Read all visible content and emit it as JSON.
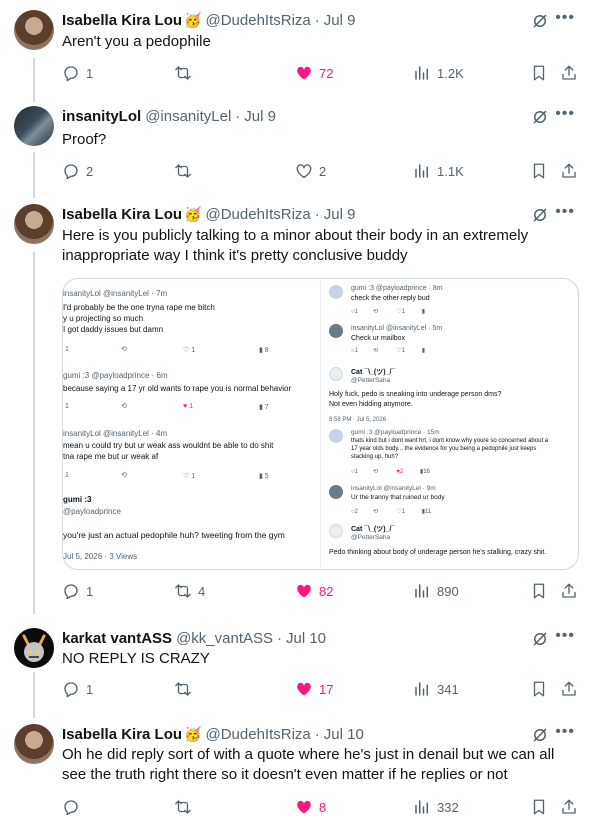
{
  "colors": {
    "like": "#f91880",
    "muted": "#536471",
    "text": "#0f1419",
    "line": "#cfd9de"
  },
  "tweets": [
    {
      "name": "Isabella Kira Lou",
      "emoji": "🥳",
      "handle": "@DudehItsRiza",
      "time": "Jul 9",
      "text": "Aren't you a pedophile",
      "replies": "1",
      "retweets": "",
      "likes": "72",
      "liked": true,
      "views": "1.2K"
    },
    {
      "name": "insanityLol",
      "emoji": "",
      "handle": "@insanityLel",
      "time": "Jul 9",
      "text": "Proof?",
      "replies": "2",
      "retweets": "",
      "likes": "2",
      "liked": false,
      "views": "1.1K"
    },
    {
      "name": "Isabella Kira Lou",
      "emoji": "🥳",
      "handle": "@DudehItsRiza",
      "time": "Jul 9",
      "text": "Here is you publicly talking to a minor about their body in an extremely inappropriate way I think it's pretty conclusive buddy",
      "replies": "1",
      "retweets": "4",
      "likes": "82",
      "liked": true,
      "views": "890"
    },
    {
      "name": "karkat vantASS",
      "emoji": "",
      "handle": "@kk_vantASS",
      "time": "Jul 10",
      "text": "NO REPLY IS CRAZY",
      "replies": "1",
      "retweets": "",
      "likes": "17",
      "liked": true,
      "views": "341"
    },
    {
      "name": "Isabella Kira Lou",
      "emoji": "🥳",
      "handle": "@DudehItsRiza",
      "time": "Jul 10",
      "text": "Oh he did reply sort of with a quote where he's just in denail but we can all see the truth right there so it doesn't even matter if he replies or not",
      "replies": "",
      "retweets": "",
      "likes": "8",
      "liked": true,
      "views": "332"
    }
  ],
  "media": {
    "left": {
      "t1_head": "insanityLol @insanityLel · 7m",
      "t1_l1": "I'd probably be the one tryna rape me bitch",
      "t1_l2": "y u projecting so much",
      "t1_l3": "I got daddy issues but damn",
      "t1_r": "1",
      "t1_l": "1",
      "t1_v": "8",
      "t2_head": "gumi :3 @payloadprince · 6m",
      "t2_l1": "because saying a 17 yr old wants to rape you is normal behavior",
      "t2_r": "1",
      "t2_l": "1",
      "t2_v": "7",
      "t3_head": "insanityLol @insanityLel · 4m",
      "t3_l1": "mean u could try but ur weak ass wouldnt be able to do shit",
      "t3_l2": "tna rape me but ur weak af",
      "t3_r": "1",
      "t3_l": "1",
      "t3_v": "5",
      "t4_name": "gumi :3",
      "t4_handle": "@payloadprince",
      "t4_l1": "you're just an actual pedophile huh? tweeting from the gym",
      "t4_meta": "Jul 5, 2026 · 3 Views"
    },
    "right": {
      "r1_head": "gumi :3 @payloadprince · 8m",
      "r1_l1": "check the other reply bud",
      "r2_head": "insanityLol @insanityLel · 5m",
      "r2_l1": "Check ur mailbox",
      "r3_name": "Cat ¯\\_(ツ)_/¯",
      "r3_handle": "@PetterSaha",
      "r3_l1": "Holy fuck, pedo is sneaking into underage person dms?",
      "r3_l2": "Not even hidding anymore.",
      "r3_meta": "8:58 PM · Jul 5, 2026",
      "r4_head": "gumi :3 @payloadprince · 15m",
      "r4_l1": "thats kind but i dont want hrt, i dont know why youre so concerned about a",
      "r4_l2": "17 year olds body... the evidence for you being a pedophile just keeps",
      "r4_l3": "stacking up, huh?",
      "r4_like": "2",
      "r4_view": "16",
      "r5_head": "insanityLol @insanityLel · 9m",
      "r5_l1": "Ur the tranny that ruined ur body",
      "r5_view": "11",
      "r6_name": "Cat ¯\\_(ツ)_/¯",
      "r6_handle": "@PetterSaha",
      "r6_l1": "Pedo thinking about body of underage person he's stalking, crazy shit."
    }
  }
}
